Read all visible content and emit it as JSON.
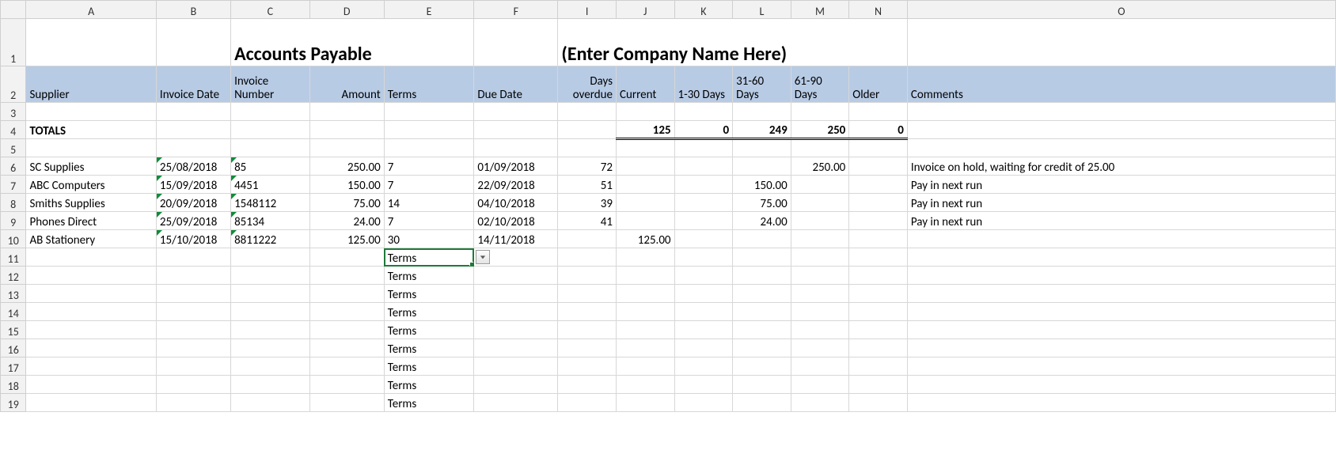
{
  "columns": [
    "A",
    "B",
    "C",
    "D",
    "E",
    "F",
    "I",
    "J",
    "K",
    "L",
    "M",
    "N",
    "O"
  ],
  "title_left": "Accounts Payable",
  "title_right": "(Enter Company Name Here)",
  "headers": {
    "A": "Supplier",
    "B": "Invoice Date",
    "C": "Invoice Number",
    "D": "Amount",
    "E": "Terms",
    "F": "Due Date",
    "I": "Days overdue",
    "J": "Current",
    "K": "1-30 Days",
    "L": "31-60 Days",
    "M": "61-90 Days",
    "N": "Older",
    "O": "Comments"
  },
  "totals": {
    "label": "TOTALS",
    "J": "125",
    "K": "0",
    "L": "249",
    "M": "250",
    "N": "0"
  },
  "rows": [
    {
      "n": 6,
      "A": "SC Supplies",
      "B": "25/08/2018",
      "C": "85",
      "D": "250.00",
      "E": "7",
      "F": "01/09/2018",
      "I": "72",
      "J": "",
      "K": "",
      "L": "",
      "M": "250.00",
      "N": "",
      "O": "Invoice on hold, waiting for credit of 25.00"
    },
    {
      "n": 7,
      "A": "ABC Computers",
      "B": "15/09/2018",
      "C": "4451",
      "D": "150.00",
      "E": "7",
      "F": "22/09/2018",
      "I": "51",
      "J": "",
      "K": "",
      "L": "150.00",
      "M": "",
      "N": "",
      "O": "Pay in next run"
    },
    {
      "n": 8,
      "A": "Smiths Supplies",
      "B": "20/09/2018",
      "C": "1548112",
      "D": "75.00",
      "E": "14",
      "F": "04/10/2018",
      "I": "39",
      "J": "",
      "K": "",
      "L": "75.00",
      "M": "",
      "N": "",
      "O": "Pay in next run"
    },
    {
      "n": 9,
      "A": "Phones Direct",
      "B": "25/09/2018",
      "C": "85134",
      "D": "24.00",
      "E": "7",
      "F": "02/10/2018",
      "I": "41",
      "J": "",
      "K": "",
      "L": "24.00",
      "M": "",
      "N": "",
      "O": "Pay in next run"
    },
    {
      "n": 10,
      "A": "AB Stationery",
      "B": "15/10/2018",
      "C": "8811222",
      "D": "125.00",
      "E": "30",
      "F": "14/11/2018",
      "I": "",
      "J": "125.00",
      "K": "",
      "L": "",
      "M": "",
      "N": "",
      "O": ""
    }
  ],
  "terms_fill": {
    "active_row": 11,
    "label": "Terms",
    "rows": [
      11,
      12,
      13,
      14,
      15,
      16,
      17,
      18,
      19
    ]
  },
  "empty_row_labels": [
    "3",
    "5"
  ]
}
